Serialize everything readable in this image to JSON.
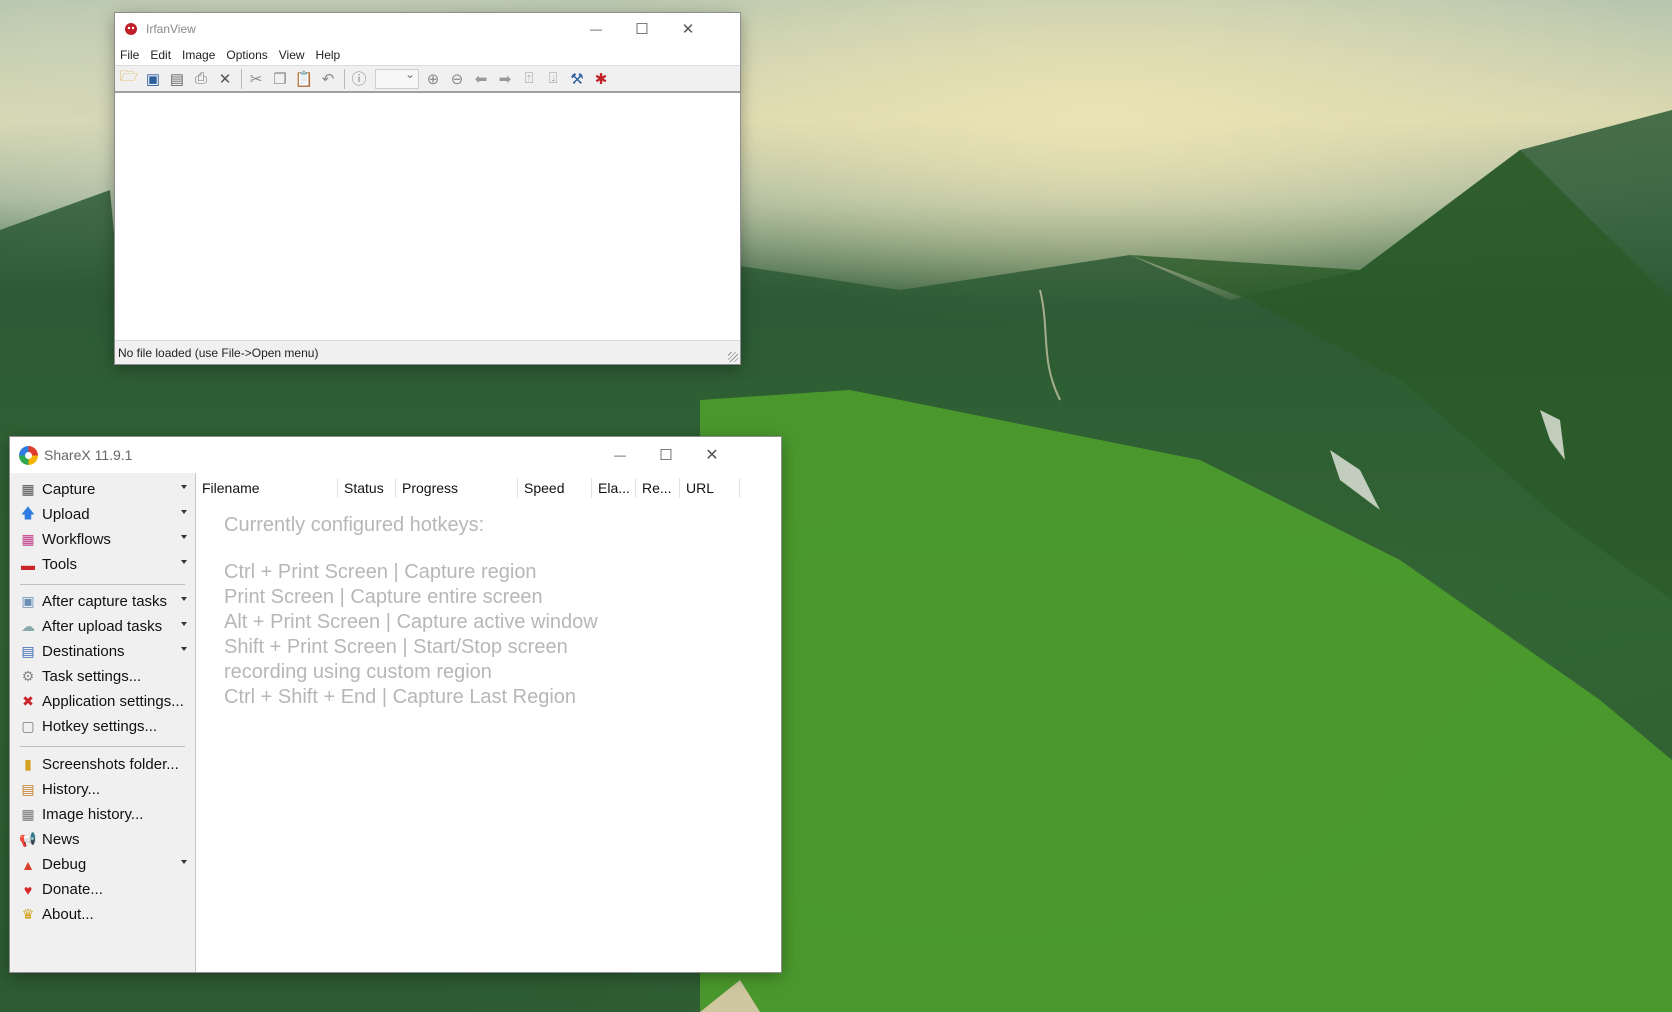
{
  "irfanview": {
    "title": "IrfanView",
    "menu": [
      "File",
      "Edit",
      "Image",
      "Options",
      "View",
      "Help"
    ],
    "toolbar_icons": [
      "open-folder-icon",
      "slideshow-icon",
      "save-icon",
      "print-icon",
      "delete-icon",
      "cut-icon",
      "copy-icon",
      "paste-icon",
      "undo-icon",
      "info-icon",
      "zoom-select",
      "zoom-in-icon",
      "zoom-out-icon",
      "previous-icon",
      "next-icon",
      "page-up-icon",
      "page-down-icon",
      "properties-icon",
      "irfanview-cat-icon"
    ],
    "status": "No file loaded (use File->Open menu)",
    "minimize": "—",
    "maximize": "☐",
    "close": "✕"
  },
  "sharex": {
    "title": "ShareX 11.9.1",
    "minimize": "—",
    "maximize": "☐",
    "close": "✕",
    "sidebar": [
      {
        "label": "Capture",
        "icon": "camera-icon",
        "glyph": "▦",
        "color": "#555",
        "arrow": true
      },
      {
        "label": "Upload",
        "icon": "upload-arrow-icon",
        "glyph": "🡅",
        "color": "#2f7de0",
        "arrow": true
      },
      {
        "label": "Workflows",
        "icon": "workflows-grid-icon",
        "glyph": "▦",
        "color": "#c23b8a",
        "arrow": true
      },
      {
        "label": "Tools",
        "icon": "toolbox-icon",
        "glyph": "▬",
        "color": "#c8262b",
        "arrow": true
      },
      {
        "label": "After capture tasks",
        "icon": "image-tasks-icon",
        "glyph": "▣",
        "color": "#6b8fb8",
        "arrow": true
      },
      {
        "label": "After upload tasks",
        "icon": "cloud-icon",
        "glyph": "☁",
        "color": "#8aa",
        "arrow": true
      },
      {
        "label": "Destinations",
        "icon": "destinations-icon",
        "glyph": "▤",
        "color": "#3a67b0",
        "arrow": true
      },
      {
        "label": "Task settings...",
        "icon": "gear-icon",
        "glyph": "⚙",
        "color": "#888",
        "arrow": false
      },
      {
        "label": "Application settings...",
        "icon": "wrench-screwdriver-icon",
        "glyph": "✖",
        "color": "#c8262b",
        "arrow": false
      },
      {
        "label": "Hotkey settings...",
        "icon": "keyboard-icon",
        "glyph": "▢",
        "color": "#777",
        "arrow": false
      },
      {
        "label": "Screenshots folder...",
        "icon": "folder-icon",
        "glyph": "▮",
        "color": "#d4a11e",
        "arrow": false
      },
      {
        "label": "History...",
        "icon": "history-icon",
        "glyph": "▤",
        "color": "#c77e2a",
        "arrow": false
      },
      {
        "label": "Image history...",
        "icon": "image-history-icon",
        "glyph": "▦",
        "color": "#777",
        "arrow": false
      },
      {
        "label": "News",
        "icon": "megaphone-icon",
        "glyph": "📢",
        "color": "#c8262b",
        "arrow": false
      },
      {
        "label": "Debug",
        "icon": "cone-icon",
        "glyph": "▲",
        "color": "#d8402a",
        "arrow": true
      },
      {
        "label": "Donate...",
        "icon": "heart-icon",
        "glyph": "♥",
        "color": "#d9262b",
        "arrow": false
      },
      {
        "label": "About...",
        "icon": "crown-icon",
        "glyph": "♛",
        "color": "#d4a11e",
        "arrow": false
      }
    ],
    "columns": [
      "Filename",
      "Status",
      "Progress",
      "Speed",
      "Ela...",
      "Re...",
      "URL"
    ],
    "hotkeys_title": "Currently configured hotkeys:",
    "hotkeys": [
      "Ctrl + Print Screen  |  Capture region",
      "Print Screen  |  Capture entire screen",
      "Alt + Print Screen  |  Capture active window",
      "Shift + Print Screen  |  Start/Stop screen",
      "recording using custom region",
      "Ctrl + Shift + End  |  Capture Last Region"
    ]
  }
}
